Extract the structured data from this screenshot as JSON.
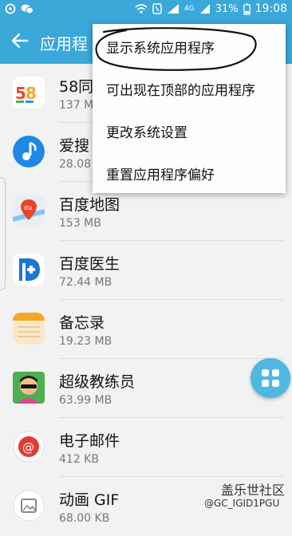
{
  "status_bar": {
    "battery_percent": "31%",
    "time": "19:08",
    "network": "4G",
    "wifi_icon": "wifi-icon",
    "signal_icon": "signal-icon"
  },
  "app_bar": {
    "title": "应用程",
    "back_icon": "back-arrow-icon"
  },
  "menu": {
    "items": [
      {
        "label": "显示系统应用程序"
      },
      {
        "label": "可出现在顶部的应用程序"
      },
      {
        "label": "更改系统设置"
      },
      {
        "label": "重置应用程序偏好"
      }
    ]
  },
  "apps": [
    {
      "name": "58同",
      "size": "137 M"
    },
    {
      "name": "爱搜",
      "size": "28.08"
    },
    {
      "name": "百度地图",
      "size": "153 MB"
    },
    {
      "name": "百度医生",
      "size": "72.44 MB"
    },
    {
      "name": "备忘录",
      "size": "19.23 MB"
    },
    {
      "name": "超级教练员",
      "size": "63.99 MB"
    },
    {
      "name": "电子邮件",
      "size": "412 KB"
    },
    {
      "name": "动画 GIF",
      "size": "68.00 KB"
    }
  ],
  "watermark": {
    "line1": "盖乐世社区",
    "line2": "@GC_IGID1PGU"
  },
  "colors": {
    "accent": "#3aa8d9",
    "fab": "#4fb8e2"
  }
}
